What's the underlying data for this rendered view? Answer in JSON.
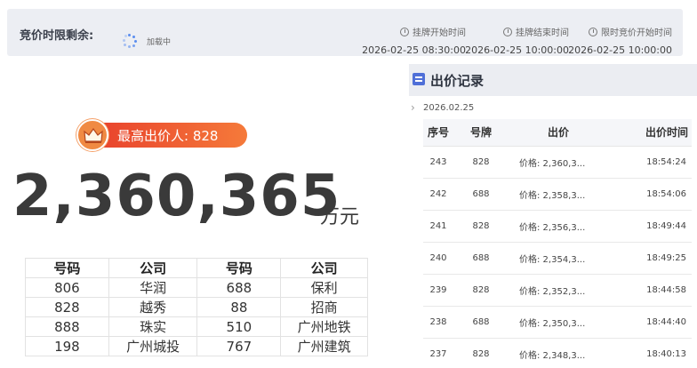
{
  "countdown": {
    "label": "竞价时限剩余:",
    "loading_text": "加载中",
    "times": [
      {
        "title": "挂牌开始时间",
        "value": "2026-02-25 08:30:00"
      },
      {
        "title": "挂牌结束时间",
        "value": "2026-02-25 10:00:00"
      },
      {
        "title": "限时竞价开始时间",
        "value": "2026-02-25 10:00:00"
      }
    ]
  },
  "highest_bidder": {
    "label": "最高出价人:",
    "number": "828",
    "icon": "crown-icon"
  },
  "price": {
    "amount": "2,360,365",
    "unit": "万元"
  },
  "company_table": {
    "headers": [
      "号码",
      "公司",
      "号码",
      "公司"
    ],
    "rows": [
      [
        "806",
        "华润",
        "688",
        "保利"
      ],
      [
        "828",
        "越秀",
        "88",
        "招商"
      ],
      [
        "888",
        "珠实",
        "510",
        "广州地铁"
      ],
      [
        "198",
        "广州城投",
        "767",
        "广州建筑"
      ]
    ]
  },
  "bid_record": {
    "title": "出价记录",
    "date": "2026.02.25",
    "headers": [
      "序号",
      "号牌",
      "出价",
      "出价时间"
    ],
    "rows": [
      {
        "seq": "243",
        "plate": "828",
        "price": "价格: 2,360,3...",
        "time": "18:54:24"
      },
      {
        "seq": "242",
        "plate": "688",
        "price": "价格: 2,358,3...",
        "time": "18:54:06"
      },
      {
        "seq": "241",
        "plate": "828",
        "price": "价格: 2,356,3...",
        "time": "18:49:44"
      },
      {
        "seq": "240",
        "plate": "688",
        "price": "价格: 2,354,3...",
        "time": "18:49:25"
      },
      {
        "seq": "239",
        "plate": "828",
        "price": "价格: 2,352,3...",
        "time": "18:44:58"
      },
      {
        "seq": "238",
        "plate": "688",
        "price": "价格: 2,350,3...",
        "time": "18:44:40"
      },
      {
        "seq": "237",
        "plate": "828",
        "price": "价格: 2,348,3...",
        "time": "18:40:13"
      }
    ]
  },
  "colors": {
    "badge_start": "#e8402c",
    "badge_end": "#f57a3a",
    "spinner": "#5b8def",
    "panel_icon": "#4f6fd8"
  }
}
